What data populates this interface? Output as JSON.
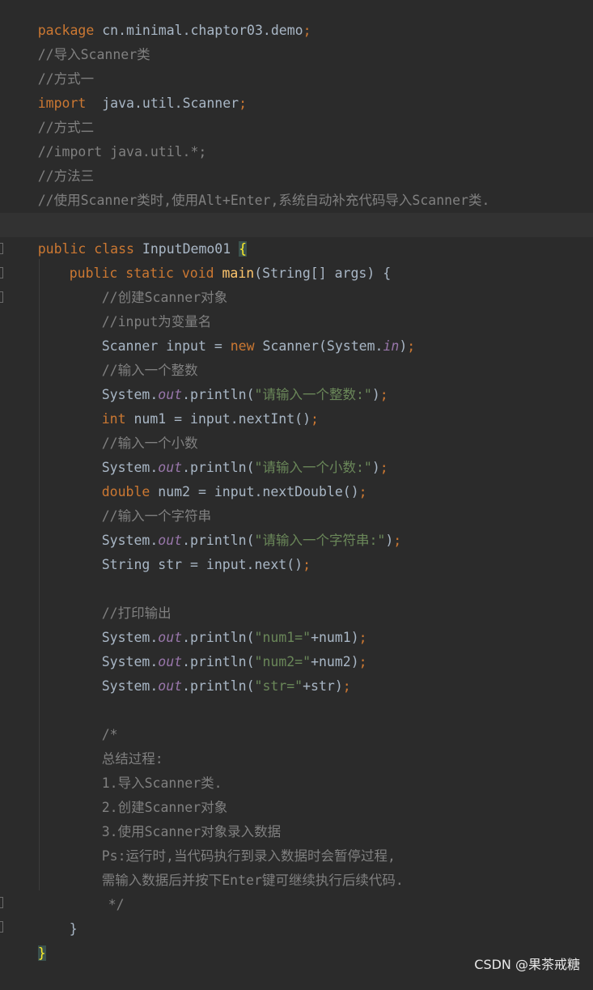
{
  "code": {
    "package_kw": "package",
    "package_name": " cn.minimal.chaptor03.demo",
    "semicolon": ";",
    "l2_comment": "//导入Scanner类",
    "l3_comment": "//方式一",
    "import_kw": "import",
    "import_path": "  java.util.Scanner",
    "l5_comment": "//方式二",
    "l6_comment": "//import java.util.*;",
    "l7_comment": "//方法三",
    "l8_comment": "//使用Scanner类时,使用Alt+Enter,系统自动补充代码导入Scanner类.",
    "class_decl_kw": "public class",
    "class_name": " InputDemo01 ",
    "open_brace": "{",
    "main_kw": "public static void",
    "main_name": "main",
    "main_params": "(String[] args) {",
    "c_create": "//创建Scanner对象",
    "c_input_var": "//input为变量名",
    "scanner_decl_a": "Scanner input = ",
    "new_kw": "new",
    "scanner_decl_b": " Scanner(System.",
    "in_field": "in",
    "close_paren": ")",
    "c_int": "//输入一个整数",
    "system_dot": "System.",
    "out_field": "out",
    "println_open": ".println(",
    "prompt_int": "\"请输入一个整数:\"",
    "int_kw": "int",
    "int_decl": " num1 = input.nextInt()",
    "c_double": "//输入一个小数",
    "prompt_double": "\"请输入一个小数:\"",
    "double_kw": "double",
    "double_decl": " num2 = input.nextDouble()",
    "c_string": "//输入一个字符串",
    "prompt_string": "\"请输入一个字符串:\"",
    "string_decl": "String str = input.next()",
    "c_print": "//打印输出",
    "lbl_num1": "\"num1=\"",
    "plus_num1": "+num1)",
    "lbl_num2": "\"num2=\"",
    "plus_num2": "+num2)",
    "lbl_str": "\"str=\"",
    "plus_str": "+str)",
    "block_open": "/*",
    "sum_title": "总结过程:",
    "sum_1": "1.导入Scanner类.",
    "sum_2": "2.创建Scanner对象",
    "sum_3": "3.使用Scanner对象录入数据",
    "sum_ps": "Ps:运行时,当代码执行到录入数据时会暂停过程,",
    "sum_ps2": "需输入数据后并按下Enter键可继续执行后续代码.",
    "block_close": "*/",
    "close_brace": "}"
  },
  "colors": {
    "background": "#2b2b2b",
    "keyword": "#cc7832",
    "comment": "#808080",
    "string": "#6a8759",
    "method": "#ffc66d",
    "static_field": "#9876aa",
    "plain": "#a9b7c6",
    "brace_highlight": "#ffef28"
  },
  "watermark": {
    "text": "CSDN @果茶戒糖"
  }
}
